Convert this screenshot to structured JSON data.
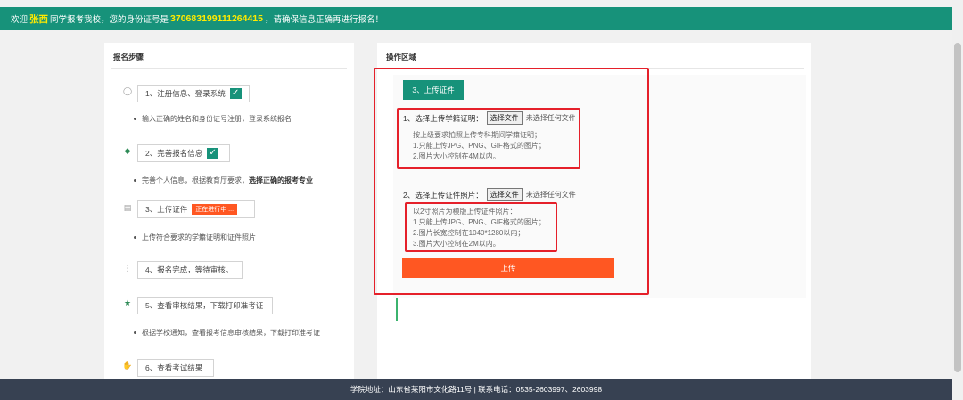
{
  "banner": {
    "prefix": "欢迎",
    "name": "张西",
    "middle": "同学报考我校，您的身份证号是",
    "id_number": "370683199111264415",
    "suffix": "，请确保信息正确再进行报名！"
  },
  "left": {
    "title": "报名步骤",
    "steps": [
      {
        "label": "1、注册信息、登录系统",
        "desc": "输入正确的姓名和身份证号注册，登录系统报名",
        "status": "done"
      },
      {
        "label": "2、完善报名信息",
        "desc": "完善个人信息，根据教育厅要求，",
        "desc_bold": "选择正确的报考专业",
        "status": "done"
      },
      {
        "label": "3、上传证件",
        "badge": "正在进行中 ...",
        "desc": "上传符合要求的学籍证明和证件照片",
        "status": "active"
      },
      {
        "label": "4、报名完成，等待审核。",
        "status": "pending"
      },
      {
        "label": "5、查看审核结果，下载打印准考证",
        "desc": "根据学校通知，查看报考信息审核结果，下载打印准考证",
        "status": "pending"
      },
      {
        "label": "6、查看考试结果",
        "status": "pending"
      }
    ]
  },
  "right": {
    "title": "操作区域",
    "tab_label": "3、上传证件",
    "item1": {
      "label": "1、选择上传学籍证明：",
      "button": "选择文件",
      "none": "未选择任何文件",
      "hints": [
        "按上级要求拍照上传专科期间学籍证明；",
        "1.只能上传JPG、PNG、GIF格式的图片；",
        "2.图片大小控制在4M以内。"
      ]
    },
    "item2": {
      "label": "2、选择上传证件照片：",
      "button": "选择文件",
      "none": "未选择任何文件",
      "hints": [
        "以2寸照片为模版上传证件照片：",
        "1.只能上传JPG、PNG、GIF格式的图片；",
        "2.图片长宽控制在1040*1280以内；",
        "3.图片大小控制在2M以内。"
      ]
    },
    "upload_label": "上传"
  },
  "footer": {
    "text": "学院地址：山东省莱阳市文化路11号 | 联系电话：0535-2603997、2603998"
  },
  "colors": {
    "primary": "#17927a",
    "accent": "#ff5722",
    "highlight": "#ffea00",
    "footer": "#374152",
    "annotation": "#e5202a"
  }
}
